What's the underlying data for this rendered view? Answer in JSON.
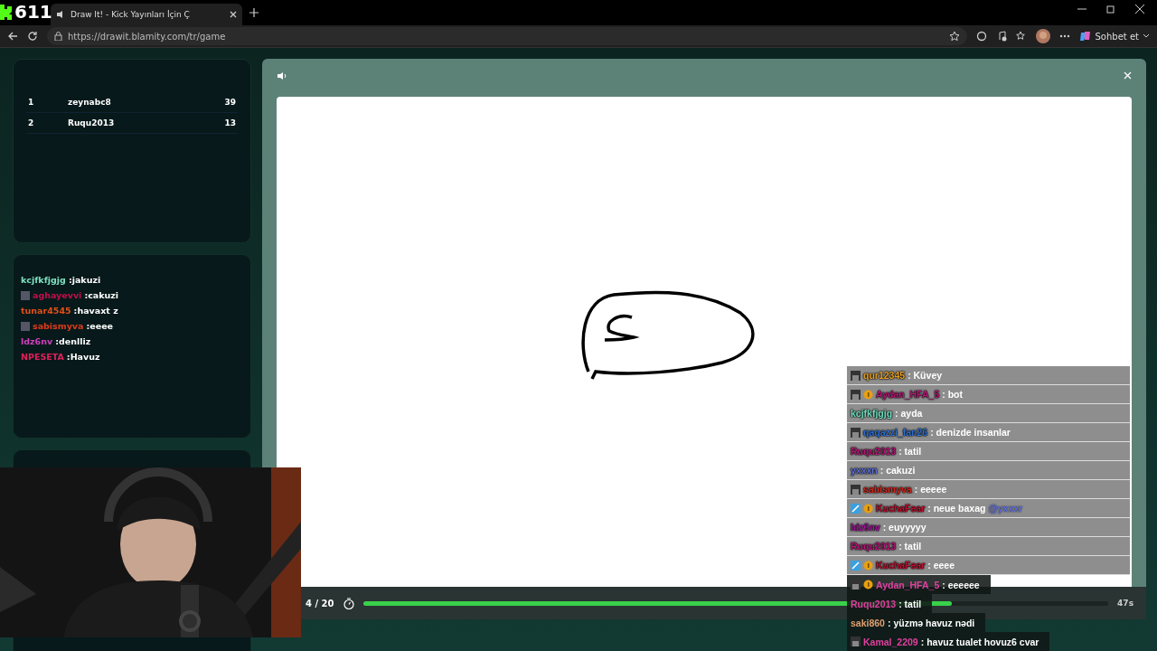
{
  "overlay_counter": "611",
  "browser": {
    "tab_title": "Draw It! - Kick Yayınları İçin Ç",
    "url": "https://drawit.blamity.com/tr/game",
    "copilot_label": "Sohbet et"
  },
  "leaderboard": [
    {
      "rank": "1",
      "name": "zeynabc8",
      "score": "39"
    },
    {
      "rank": "2",
      "name": "Ruqu2013",
      "score": "13"
    }
  ],
  "game_chat": [
    {
      "user": "kcjfkfjgjg",
      "message": ":jakuzi",
      "color": "#7fe0c0",
      "avatar": false
    },
    {
      "user": "aghayevvi",
      "message": ":cakuzi",
      "color": "#c0104a",
      "avatar": true
    },
    {
      "user": "tunar4545",
      "message": ":havaxt z",
      "color": "#e0501a",
      "avatar": false
    },
    {
      "user": "sabismyva",
      "message": ":eeee",
      "color": "#e03a1a",
      "avatar": true
    },
    {
      "user": "ldz6nv",
      "message": ":denlliz",
      "color": "#d040c0",
      "avatar": false
    },
    {
      "user": "NPESETA",
      "message": ":Havuz",
      "color": "#e0205a",
      "avatar": false
    }
  ],
  "round": "4 / 20",
  "timer": {
    "level": 0.79,
    "reading": "47s"
  },
  "stream_chat": [
    {
      "user": "qur12345",
      "message": ": Küvey",
      "color": "#e8a020",
      "avatar": true,
      "coin": false,
      "mod": false,
      "kind": "boxed"
    },
    {
      "user": "Aydan_HFA_5",
      "message": ": bot",
      "color": "#b81878",
      "avatar": true,
      "coin": true,
      "mod": false,
      "kind": "boxed"
    },
    {
      "user": "kcjfkfjgjg",
      "message": ": ayda",
      "color": "#70e0c0",
      "avatar": false,
      "coin": false,
      "mod": false,
      "kind": "boxed"
    },
    {
      "user": "qaqazzi_fan26",
      "message": ": denizde insanlar",
      "color": "#3070d0",
      "avatar": true,
      "coin": false,
      "mod": false,
      "kind": "boxed"
    },
    {
      "user": "Ruqu2013",
      "message": ": tatil",
      "color": "#b81878",
      "avatar": false,
      "coin": false,
      "mod": false,
      "kind": "boxed"
    },
    {
      "user": "yxxxn",
      "message": ": cakuzi",
      "color": "#6070e0",
      "avatar": false,
      "coin": false,
      "mod": false,
      "kind": "boxed"
    },
    {
      "user": "sabismyva",
      "message": ": eeeee",
      "color": "#d02a20",
      "avatar": true,
      "coin": false,
      "mod": false,
      "kind": "boxed"
    },
    {
      "user": "KuchaFear",
      "message": ": neue baxag",
      "mention": "@yxxxr",
      "color": "#c01030",
      "avatar": false,
      "coin": true,
      "mod": true,
      "kind": "boxed"
    },
    {
      "user": "ldz6nv",
      "message": ": euyyyyy",
      "color": "#a0189a",
      "avatar": false,
      "coin": false,
      "mod": false,
      "kind": "boxed"
    },
    {
      "user": "Ruqu2013",
      "message": ": tatil",
      "color": "#b81878",
      "avatar": false,
      "coin": false,
      "mod": false,
      "kind": "boxed"
    },
    {
      "user": "KuchaFear",
      "message": ": eeee",
      "color": "#c01030",
      "avatar": false,
      "coin": true,
      "mod": true,
      "kind": "boxed"
    },
    {
      "user": "Aydan_HFA_5",
      "message": ": eeeeee",
      "color": "#e040a0",
      "avatar": true,
      "coin": true,
      "mod": false,
      "kind": "plain"
    },
    {
      "user": "Ruqu2013",
      "message": ": tatil",
      "color": "#e040a0",
      "avatar": false,
      "coin": false,
      "mod": false,
      "kind": "plain"
    },
    {
      "user": "saki860",
      "message": ": yüzmə havuz nədi",
      "color": "#e0a070",
      "avatar": false,
      "coin": false,
      "mod": false,
      "kind": "plain"
    },
    {
      "user": "Kamal_2209",
      "message": ": havuz tualet hovuz6 cvar",
      "color": "#e040a0",
      "avatar": true,
      "coin": false,
      "mod": false,
      "kind": "plain"
    }
  ]
}
